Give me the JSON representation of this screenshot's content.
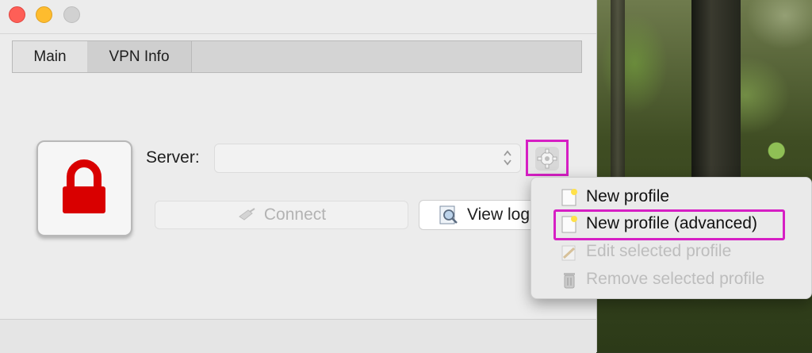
{
  "window": {
    "traffic_lights": [
      "close",
      "minimize",
      "zoom"
    ]
  },
  "tabs": [
    {
      "label": "Main",
      "selected": true
    },
    {
      "label": "VPN Info",
      "selected": false
    }
  ],
  "server": {
    "label": "Server:",
    "value": ""
  },
  "buttons": {
    "connect_label": "Connect",
    "view_log_label": "View log"
  },
  "gear_menu": {
    "items": [
      {
        "label": "New profile",
        "icon": "new-document-icon",
        "enabled": true
      },
      {
        "label": "New profile (advanced)",
        "icon": "new-document-icon",
        "enabled": true,
        "highlighted": true
      },
      {
        "label": "Edit selected profile",
        "icon": "pencil-icon",
        "enabled": false
      },
      {
        "label": "Remove selected profile",
        "icon": "trash-icon",
        "enabled": false
      }
    ]
  },
  "colors": {
    "lock": "#d90000",
    "highlight": "#d61fc4",
    "window_bg": "#ececec"
  }
}
